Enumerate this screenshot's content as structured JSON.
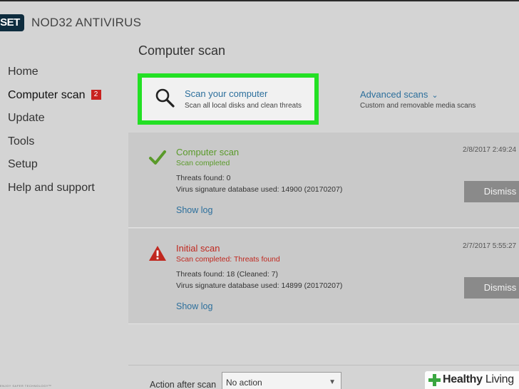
{
  "app": {
    "logo_text": "SET",
    "title": "NOD32 ANTIVIRUS"
  },
  "sidebar": {
    "items": [
      {
        "label": "Home"
      },
      {
        "label": "Computer scan",
        "badge": "2"
      },
      {
        "label": "Update"
      },
      {
        "label": "Tools"
      },
      {
        "label": "Setup"
      },
      {
        "label": "Help and support"
      }
    ],
    "footer": "ENJOY SAFER TECHNOLOGY™"
  },
  "main": {
    "page_title": "Computer scan",
    "scan_option": {
      "title": "Scan your computer",
      "subtitle": "Scan all local disks and clean threats",
      "icon": "magnifier-icon"
    },
    "advanced": {
      "title": "Advanced scans",
      "chevron": "⌄",
      "subtitle": "Custom and removable media scans"
    },
    "results": [
      {
        "title": "Computer scan",
        "status": "Scan completed",
        "line1": "Threats found: 0",
        "line2": "Virus signature database used: 14900 (20170207)",
        "log_link": "Show log",
        "date": "2/8/2017 2:49:24",
        "dismiss": "Dismiss",
        "icon": "checkmark-icon"
      },
      {
        "title": "Initial scan",
        "status": "Scan completed: Threats found",
        "line1": "Threats found: 18 (Cleaned: 7)",
        "line2": "Virus signature database used: 14899 (20170207)",
        "log_link": "Show log",
        "date": "2/7/2017 5:55:27",
        "dismiss": "Dismiss",
        "icon": "warning-icon"
      }
    ]
  },
  "bottom": {
    "action_label": "Action after scan",
    "action_value": "No action"
  },
  "watermark": {
    "brand_bold": "Healthy",
    "brand_light": "Living"
  },
  "colors": {
    "highlight": "#23e024",
    "link": "#2c6f9c",
    "success": "#5a9a2a",
    "danger": "#c0281f",
    "badge": "#c8221f"
  }
}
